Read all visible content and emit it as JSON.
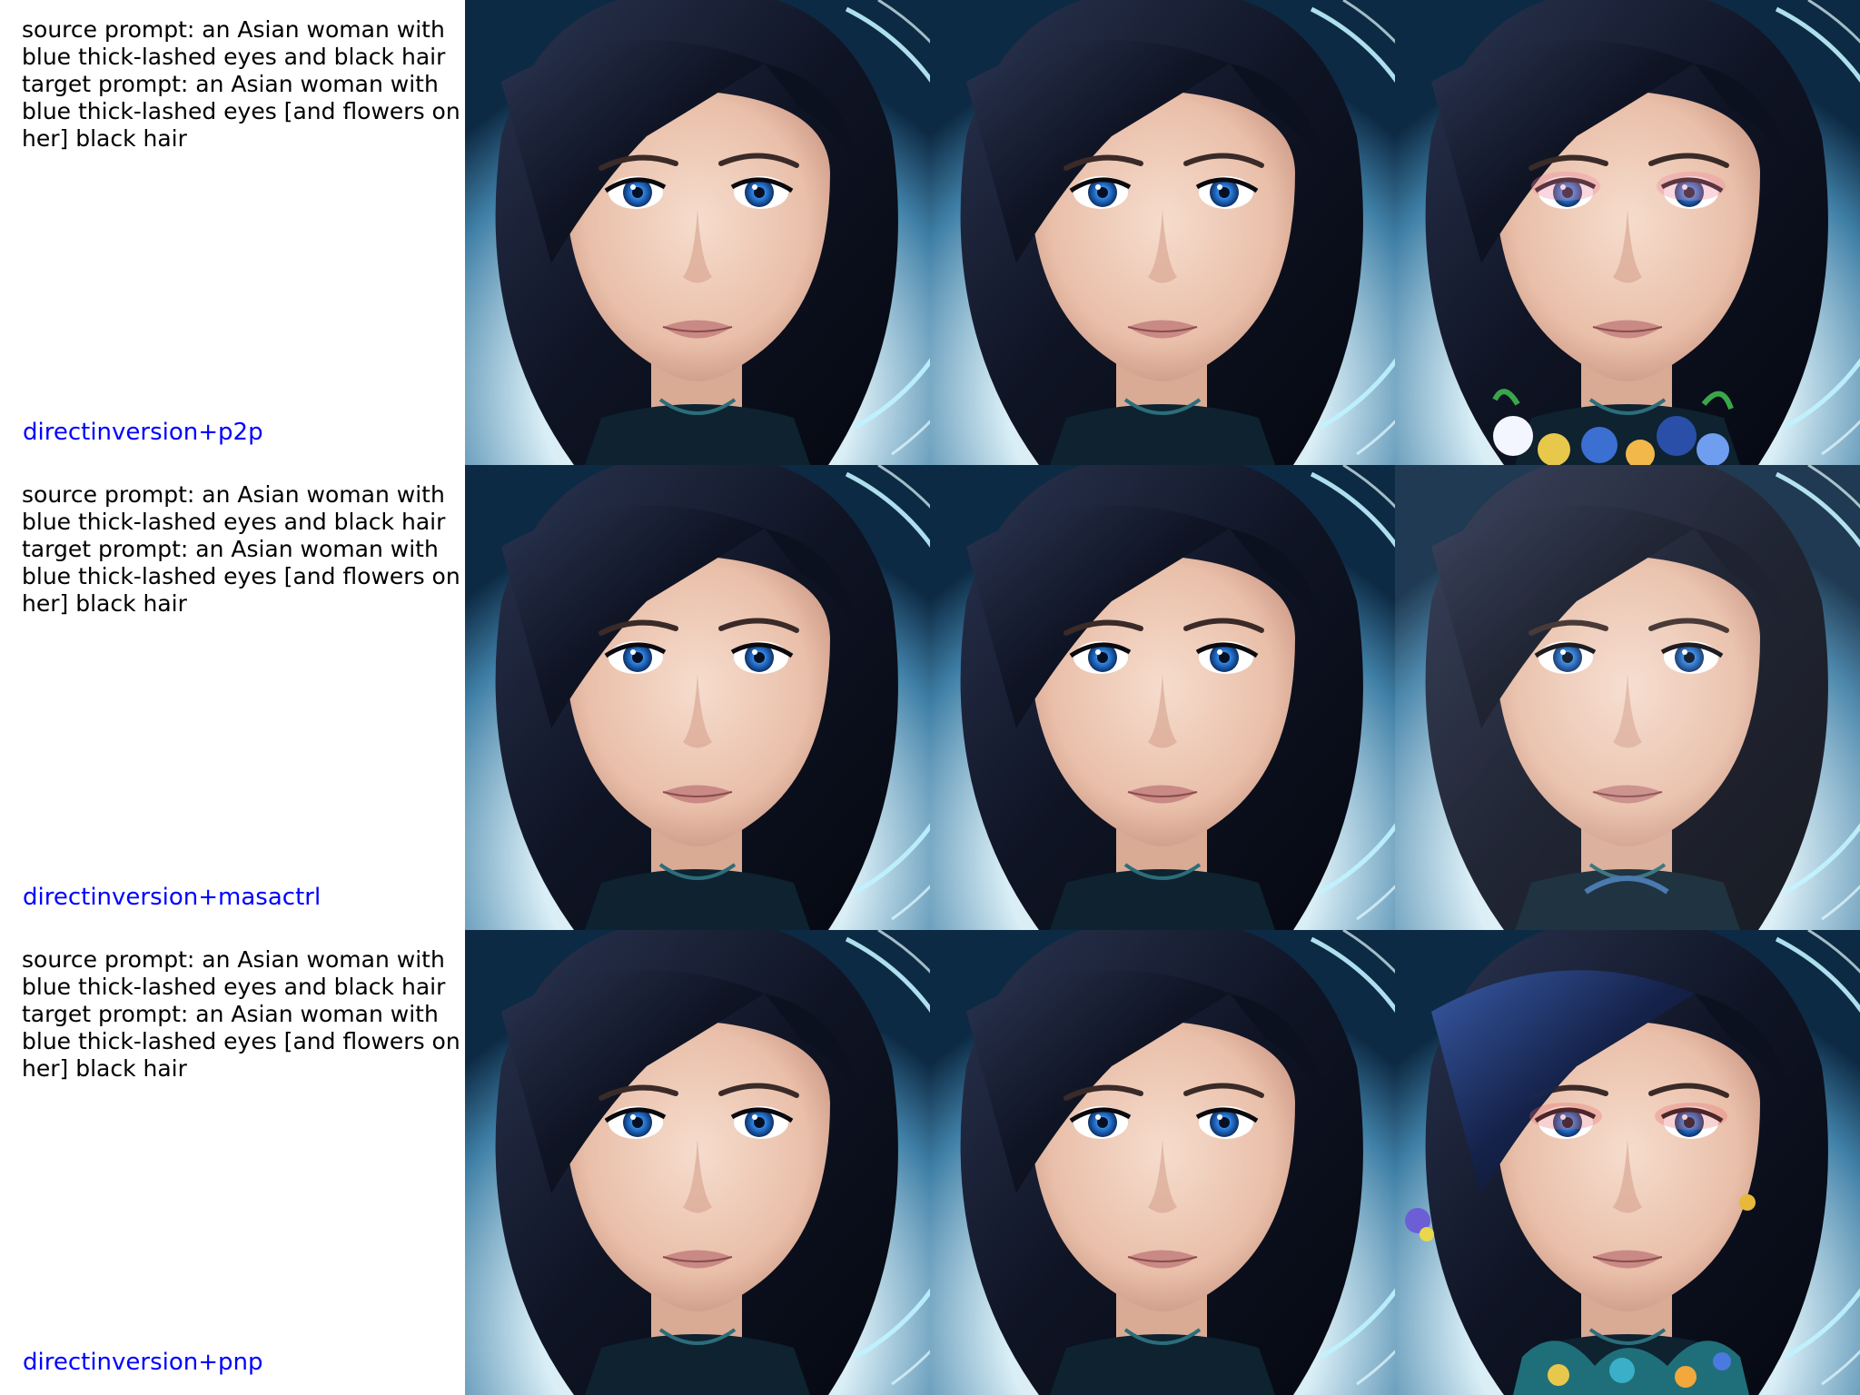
{
  "rows": [
    {
      "prompt": "source prompt: an Asian woman with\nblue thick-lashed eyes and black hair\ntarget prompt: an Asian woman with\nblue thick-lashed eyes [and flowers on\nher] black hair",
      "method": "directinversion+p2p",
      "images": [
        {
          "variant": "source",
          "flowers": false
        },
        {
          "variant": "source",
          "flowers": false
        },
        {
          "variant": "edited-pink-eyeshadow",
          "flowers": true
        }
      ]
    },
    {
      "prompt": "source prompt: an Asian woman with\nblue thick-lashed eyes and black hair\ntarget prompt: an Asian woman with\nblue thick-lashed eyes [and flowers on\nher] black hair",
      "method": "directinversion+masactrl",
      "images": [
        {
          "variant": "source",
          "flowers": false
        },
        {
          "variant": "source",
          "flowers": false
        },
        {
          "variant": "edited-soft",
          "flowers": false
        }
      ]
    },
    {
      "prompt": "source prompt: an Asian woman with\nblue thick-lashed eyes and black hair\ntarget prompt: an Asian woman with\nblue thick-lashed eyes [and flowers on\nher] black hair",
      "method": "directinversion+pnp",
      "images": [
        {
          "variant": "source",
          "flowers": false
        },
        {
          "variant": "source",
          "flowers": false
        },
        {
          "variant": "edited-blue-hair",
          "flowers": true
        }
      ]
    }
  ],
  "colors": {
    "method_label": "#0000ff",
    "prompt_text": "#000000",
    "background": "#ffffff",
    "hair": "#141a2e",
    "iris": "#2a7fe0",
    "glow": "#9fe6ff",
    "skin": "#efc8b4"
  }
}
